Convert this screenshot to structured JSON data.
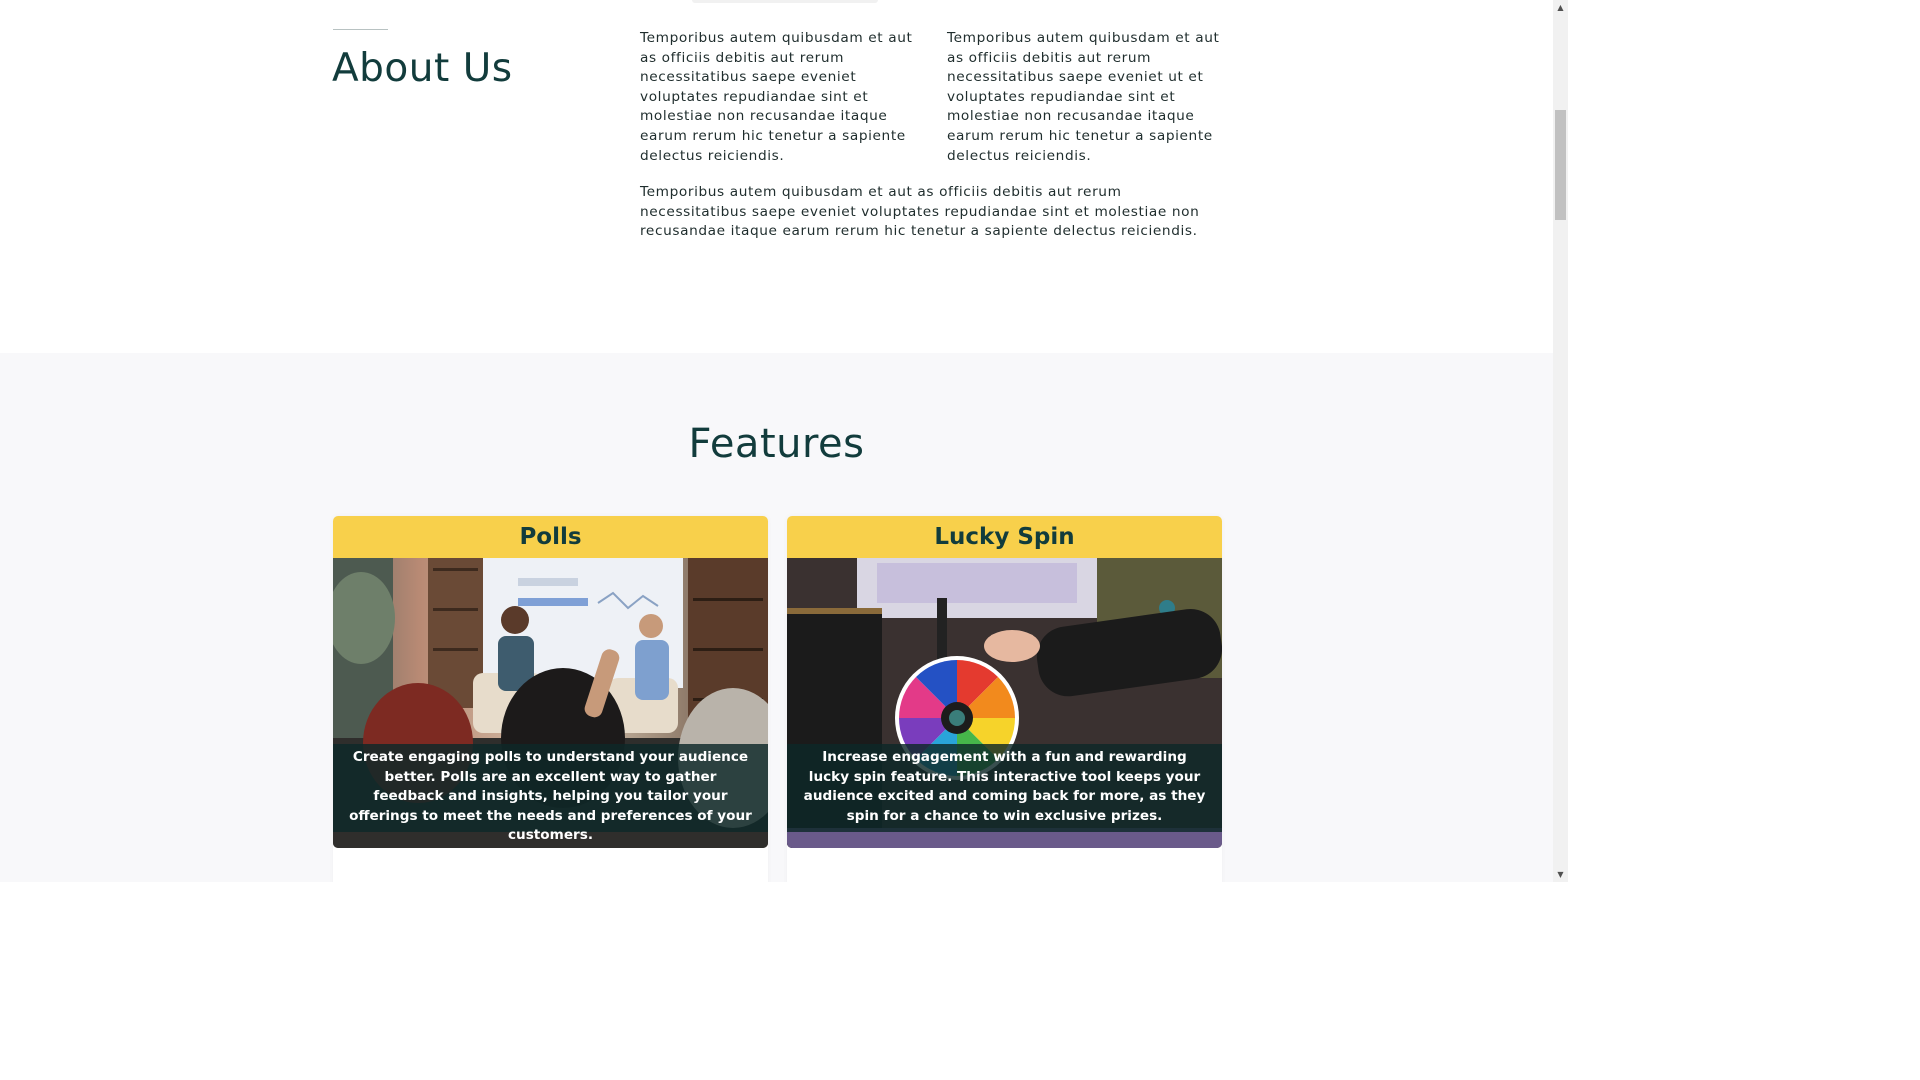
{
  "about": {
    "title": "About Us",
    "paragraph_1": "Temporibus autem quibusdam et aut as officiis debitis aut rerum necessitatibus saepe eveniet voluptates repudiandae sint et molestiae non recusandae itaque earum rerum hic tenetur a sapiente delectus reiciendis.",
    "paragraph_2": "Temporibus autem quibusdam et aut as officiis debitis aut rerum necessitatibus saepe eveniet ut et voluptates repudiandae sint et molestiae non recusandae itaque earum rerum hic tenetur a sapiente delectus reiciendis.",
    "paragraph_3": "Temporibus autem quibusdam et aut as officiis debitis aut rerum necessitatibus saepe eveniet voluptates repudiandae sint et molestiae non recusandae itaque earum rerum hic tenetur a sapiente delectus reiciendis."
  },
  "features": {
    "title": "Features",
    "cards": [
      {
        "title": "Polls",
        "description": "Create engaging polls to understand your audience better. Polls are an excellent way to gather feedback and insights, helping you tailor your offerings to meet the needs and preferences of your customers."
      },
      {
        "title": "Lucky Spin",
        "description": "Increase engagement with a fun and rewarding lucky spin feature. This interactive tool keeps your audience excited and coming back for more, as they spin for a chance to win exclusive prizes."
      }
    ]
  },
  "colors": {
    "heading": "#123c3c",
    "card_header": "#f8d04b",
    "section_bg": "#f8f8fa"
  }
}
